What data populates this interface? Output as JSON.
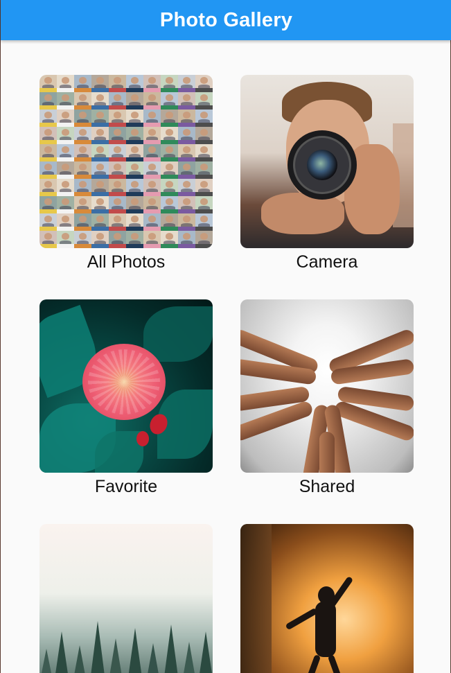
{
  "app": {
    "title": "Photo Gallery",
    "accent_color": "#2196F3",
    "background_color": "#fafafa"
  },
  "albums": [
    {
      "label": "All Photos",
      "image": "portrait-mosaic"
    },
    {
      "label": "Camera",
      "image": "man-holding-camera"
    },
    {
      "label": "Favorite",
      "image": "pink-gerbera-flower"
    },
    {
      "label": "Shared",
      "image": "hands-forming-heart"
    },
    {
      "label": "",
      "image": "misty-pine-forest"
    },
    {
      "label": "",
      "image": "silhouette-dancer-sunset"
    }
  ]
}
